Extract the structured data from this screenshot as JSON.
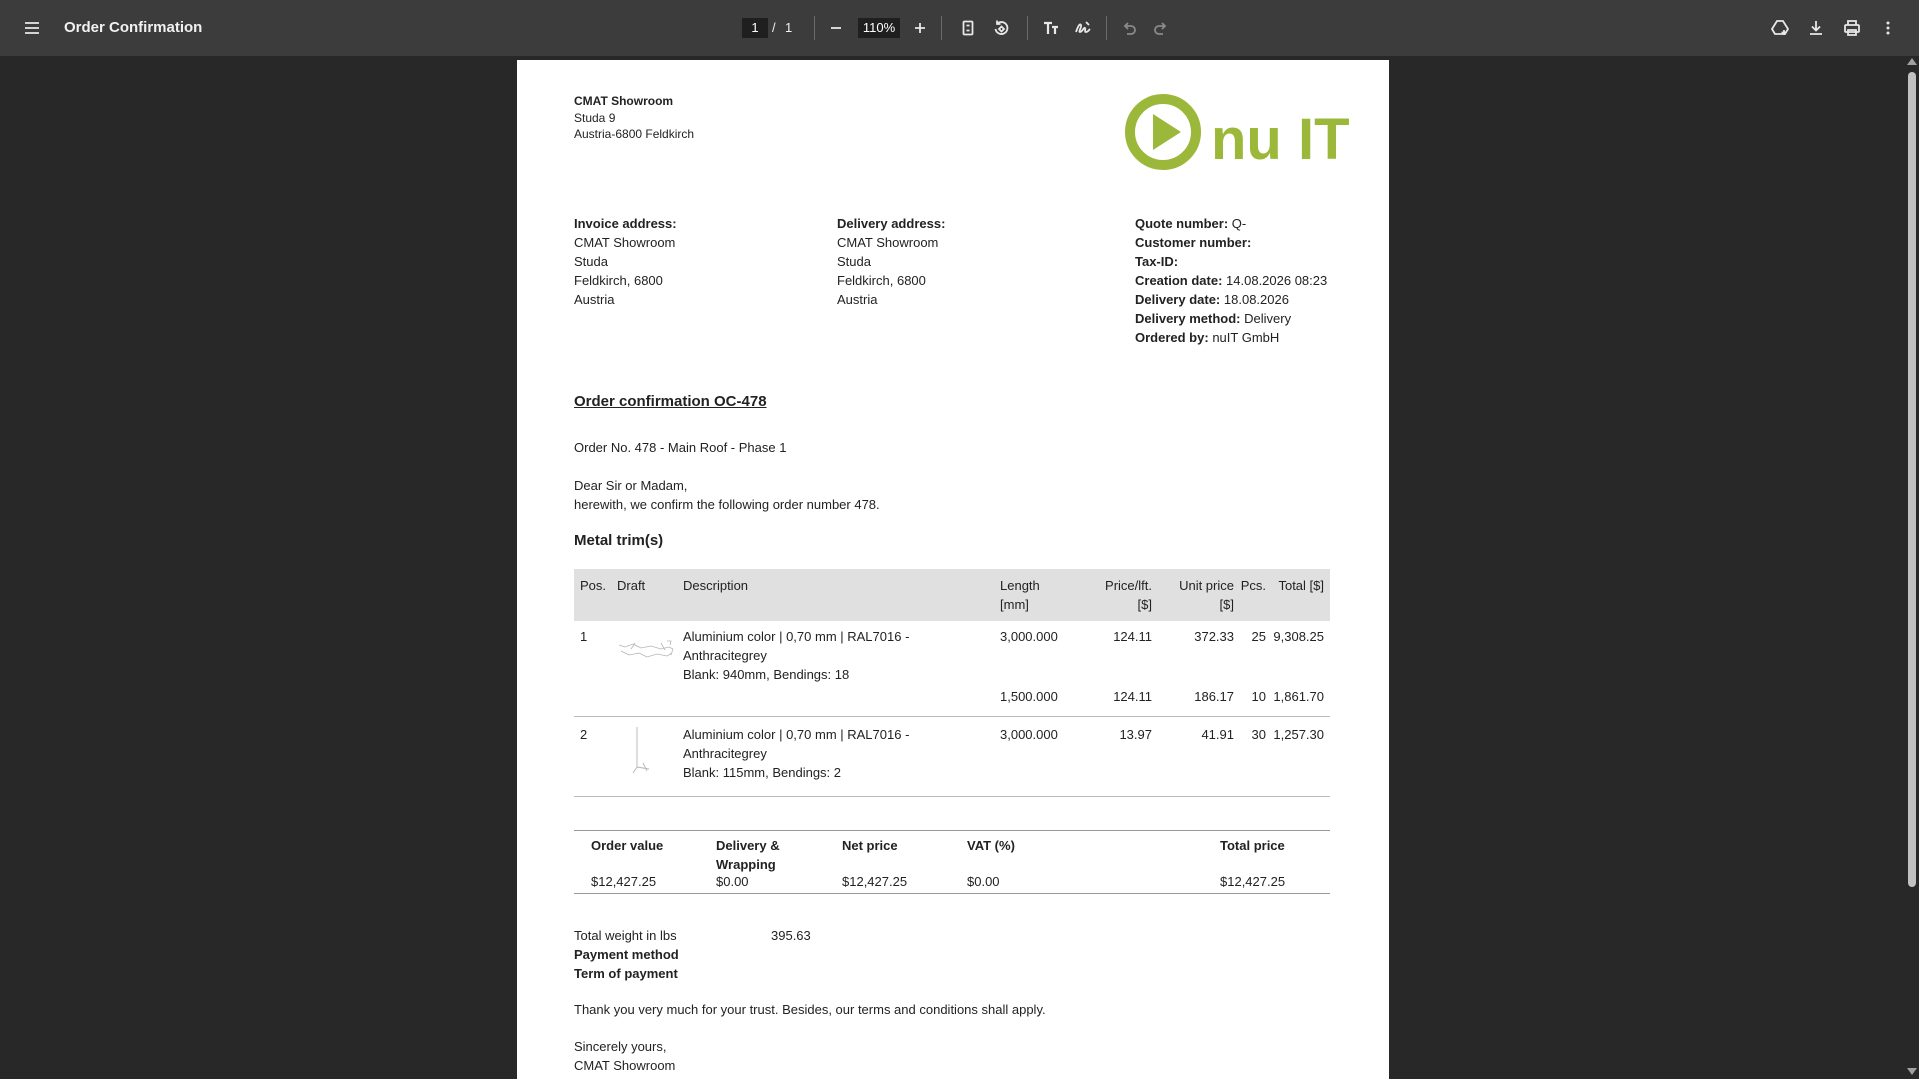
{
  "toolbar": {
    "menu_icon": "hamburger-menu-icon",
    "title": "Order Confirmation",
    "page_current": "1",
    "page_separator": "/",
    "page_total": "1",
    "zoom": "110%"
  },
  "sender": {
    "name": "CMAT Showroom",
    "street": "Studa 9",
    "city": "Austria-6800 Feldkirch"
  },
  "logo": {
    "text": "nu IT",
    "color": "#9cb83a"
  },
  "invoice": {
    "label": "Invoice address:",
    "lines": [
      "CMAT Showroom",
      "Studa",
      "Feldkirch, 6800",
      "Austria"
    ]
  },
  "delivery": {
    "label": "Delivery address:",
    "lines": [
      "CMAT Showroom",
      "Studa",
      "Feldkirch, 6800",
      "Austria"
    ]
  },
  "meta": [
    {
      "label": "Quote number:",
      "value": "Q-"
    },
    {
      "label": "Customer number:",
      "value": ""
    },
    {
      "label": "Tax-ID:",
      "value": ""
    },
    {
      "label": "Creation date:",
      "value": "14.08.2026 08:23"
    },
    {
      "label": "Delivery date:",
      "value": "18.08.2026"
    },
    {
      "label": "Delivery method:",
      "value": "Delivery"
    },
    {
      "label": "Ordered by:",
      "value": "nuIT GmbH"
    }
  ],
  "oc_title": "Order confirmation OC-478",
  "order_no": "Order No. 478 - Main Roof - Phase 1",
  "greeting": "Dear Sir or Madam,",
  "intro": "herewith, we confirm the following order number 478.",
  "section_title": "Metal trim(s)",
  "table": {
    "headers": {
      "pos": "Pos.",
      "draft": "Draft",
      "description": "Description",
      "length": "Length",
      "length_unit": "[mm]",
      "price_lft": "Price/lft.",
      "price_lft_unit": "[$]",
      "unit_price": "Unit price",
      "unit_price_unit": "[$]",
      "pcs": "Pcs.",
      "total": "Total [$]"
    },
    "rows": [
      {
        "pos": "1",
        "desc1": "Aluminium color | 0,70 mm | RAL7016 -",
        "desc2": "Anthracitegrey",
        "desc3": "Blank: 940mm, Bendings: 18",
        "length": "3,000.000",
        "price_lft": "124.11",
        "unit_price": "372.33",
        "pcs": "25",
        "total": "9,308.25"
      },
      {
        "pos": "",
        "desc1": "",
        "desc2": "",
        "desc3": "",
        "length": "1,500.000",
        "price_lft": "124.11",
        "unit_price": "186.17",
        "pcs": "10",
        "total": "1,861.70"
      },
      {
        "pos": "2",
        "desc1": "Aluminium color | 0,70 mm | RAL7016 -",
        "desc2": "Anthracitegrey",
        "desc3": "Blank: 115mm, Bendings: 2",
        "length": "3,000.000",
        "price_lft": "13.97",
        "unit_price": "41.91",
        "pcs": "30",
        "total": "1,257.30"
      }
    ]
  },
  "summary": {
    "order_value_label": "Order value",
    "delivery_label_1": "Delivery &",
    "delivery_label_2": "Wrapping",
    "net_label": "Net price",
    "vat_label": "VAT (%)",
    "total_label": "Total price",
    "order_value": "$12,427.25",
    "delivery": "$0.00",
    "net": "$12,427.25",
    "vat": "$0.00",
    "total": "$12,427.25"
  },
  "footer": {
    "weight_label": "Total weight in lbs",
    "weight_value": "395.63",
    "payment_method_label": "Payment method",
    "term_label": "Term of payment",
    "thanks": "Thank you very much for your trust. Besides, our terms and conditions shall apply.",
    "closing": "Sincerely yours,",
    "signer": "CMAT Showroom"
  }
}
